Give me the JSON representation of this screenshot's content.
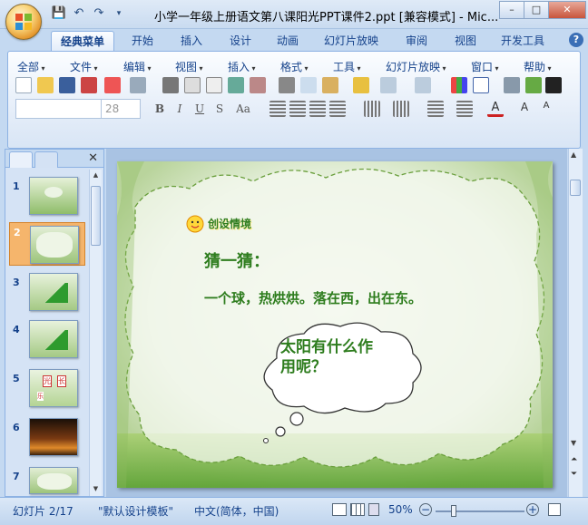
{
  "window": {
    "title": "小学一年级上册语文第八课阳光PPT课件2.ppt [兼容模式] - Mic...",
    "controls": [
      "–",
      "□",
      "✕"
    ]
  },
  "quick_access": [
    "save-icon",
    "undo-icon",
    "redo-icon"
  ],
  "tabs": [
    "经典菜单",
    "开始",
    "插入",
    "设计",
    "动画",
    "幻灯片放映",
    "审阅",
    "视图",
    "开发工具"
  ],
  "menus": [
    "全部",
    "文件",
    "编辑",
    "视图",
    "插入",
    "格式",
    "工具",
    "幻灯片放映",
    "窗口",
    "帮助"
  ],
  "font": {
    "name": "",
    "size": "28"
  },
  "format_buttons": [
    "B",
    "I",
    "U",
    "S",
    "Aa"
  ],
  "slides": [
    {
      "num": "1"
    },
    {
      "num": "2"
    },
    {
      "num": "3"
    },
    {
      "num": "4"
    },
    {
      "num": "5"
    },
    {
      "num": "6"
    },
    {
      "num": "7"
    }
  ],
  "slide5_labels": [
    "光",
    "长",
    "乐"
  ],
  "slide": {
    "badge": "创设情境",
    "heading": "猜一猜：",
    "riddle": "一个球，热烘烘。落在西，出在东。",
    "bubble_line1": "太阳有什么作",
    "bubble_line2": "用呢？"
  },
  "status": {
    "slide_num": "幻灯片 2/17",
    "template": "\"默认设计模板\"",
    "language": "中文(简体，中国)",
    "zoom": "50%"
  },
  "colors": {
    "ribbon_blue": "#c4d9f1",
    "text_blue": "#15428b",
    "slide_green": "#2e7d1e",
    "heading_green": "#5a8f1f"
  }
}
